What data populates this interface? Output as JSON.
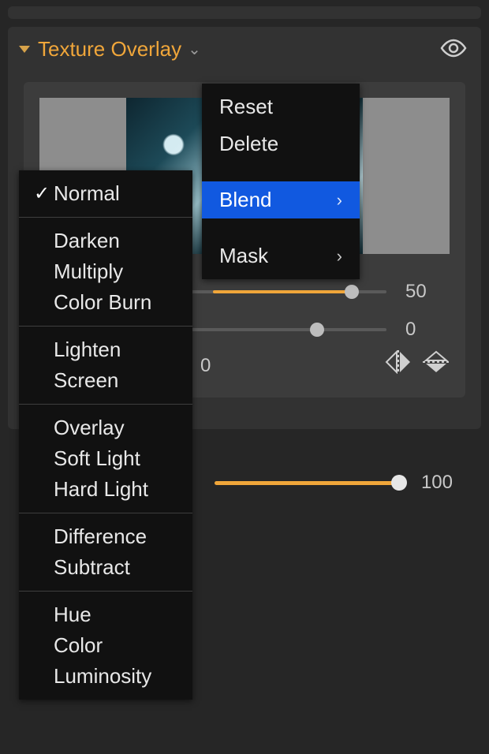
{
  "panel": {
    "title": "Texture Overlay"
  },
  "sliders": {
    "s1": {
      "value": 50
    },
    "s2": {
      "value": 0
    },
    "angle_zero": "0",
    "opacity": {
      "value": 100
    }
  },
  "context_menu": {
    "reset": "Reset",
    "delete": "Delete",
    "blend": "Blend",
    "mask": "Mask"
  },
  "blend_modes": {
    "selected": "Normal",
    "groups": [
      [
        "Normal"
      ],
      [
        "Darken",
        "Multiply",
        "Color Burn"
      ],
      [
        "Lighten",
        "Screen"
      ],
      [
        "Overlay",
        "Soft Light",
        "Hard Light"
      ],
      [
        "Difference",
        "Subtract"
      ],
      [
        "Hue",
        "Color",
        "Luminosity"
      ]
    ]
  }
}
